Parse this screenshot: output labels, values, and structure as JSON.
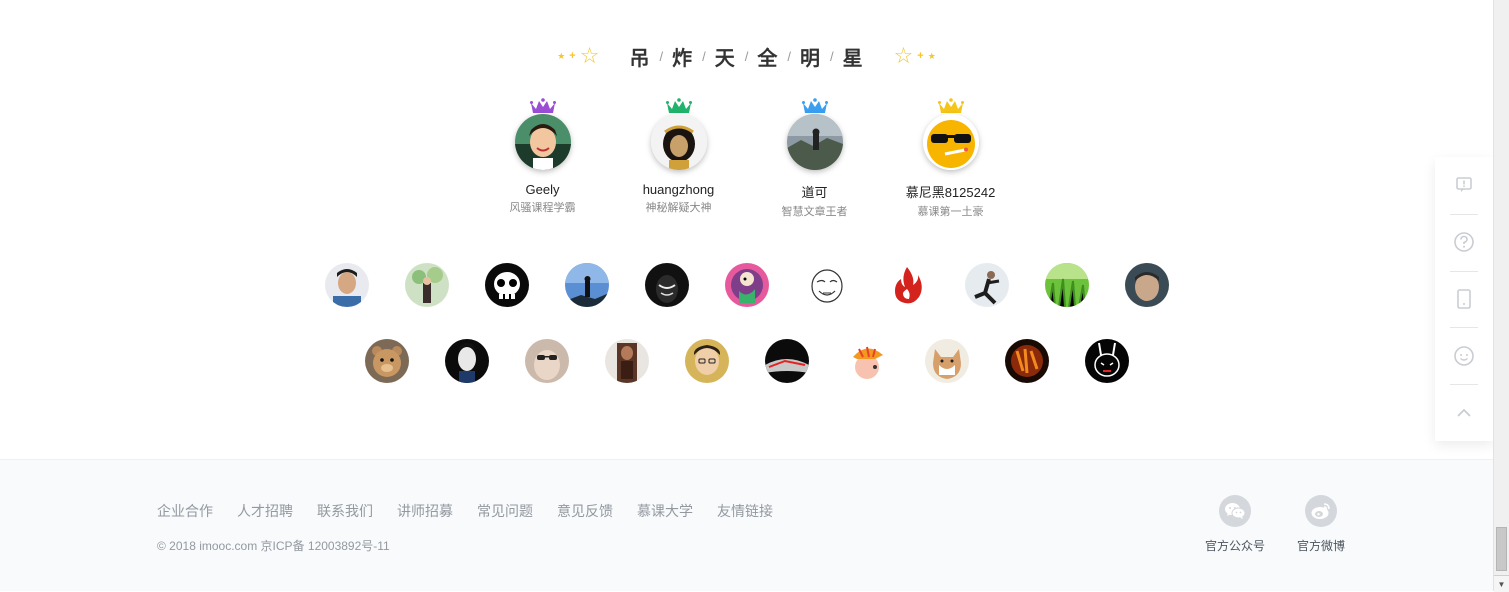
{
  "title": {
    "chars": [
      "吊",
      "炸",
      "天",
      "全",
      "明",
      "星"
    ],
    "separator": "/",
    "accent_color": "#f7c52c"
  },
  "top_stars": [
    {
      "name": "Geely",
      "desc": "风骚课程学霸",
      "crown_color": "#9b4dd6"
    },
    {
      "name": "huangzhong",
      "desc": "神秘解疑大神",
      "crown_color": "#1fb36b"
    },
    {
      "name": "道可",
      "desc": "智慧文章王者",
      "crown_color": "#3a9ff0"
    },
    {
      "name": "慕尼黑8125242",
      "desc": "慕课第一土豪",
      "crown_color": "#f5c518"
    }
  ],
  "float_bar": {
    "items": [
      "feedback-icon",
      "help-icon",
      "mobile-icon",
      "smile-icon",
      "back-to-top-icon"
    ]
  },
  "footer": {
    "links": [
      "企业合作",
      "人才招聘",
      "联系我们",
      "讲师招募",
      "常见问题",
      "意见反馈",
      "慕课大学",
      "友情链接"
    ],
    "copyright": "© 2018 imooc.com  京ICP备 12003892号-11",
    "social": [
      {
        "label": "官方公众号",
        "icon": "wechat-icon"
      },
      {
        "label": "官方微博",
        "icon": "weibo-icon"
      }
    ]
  }
}
